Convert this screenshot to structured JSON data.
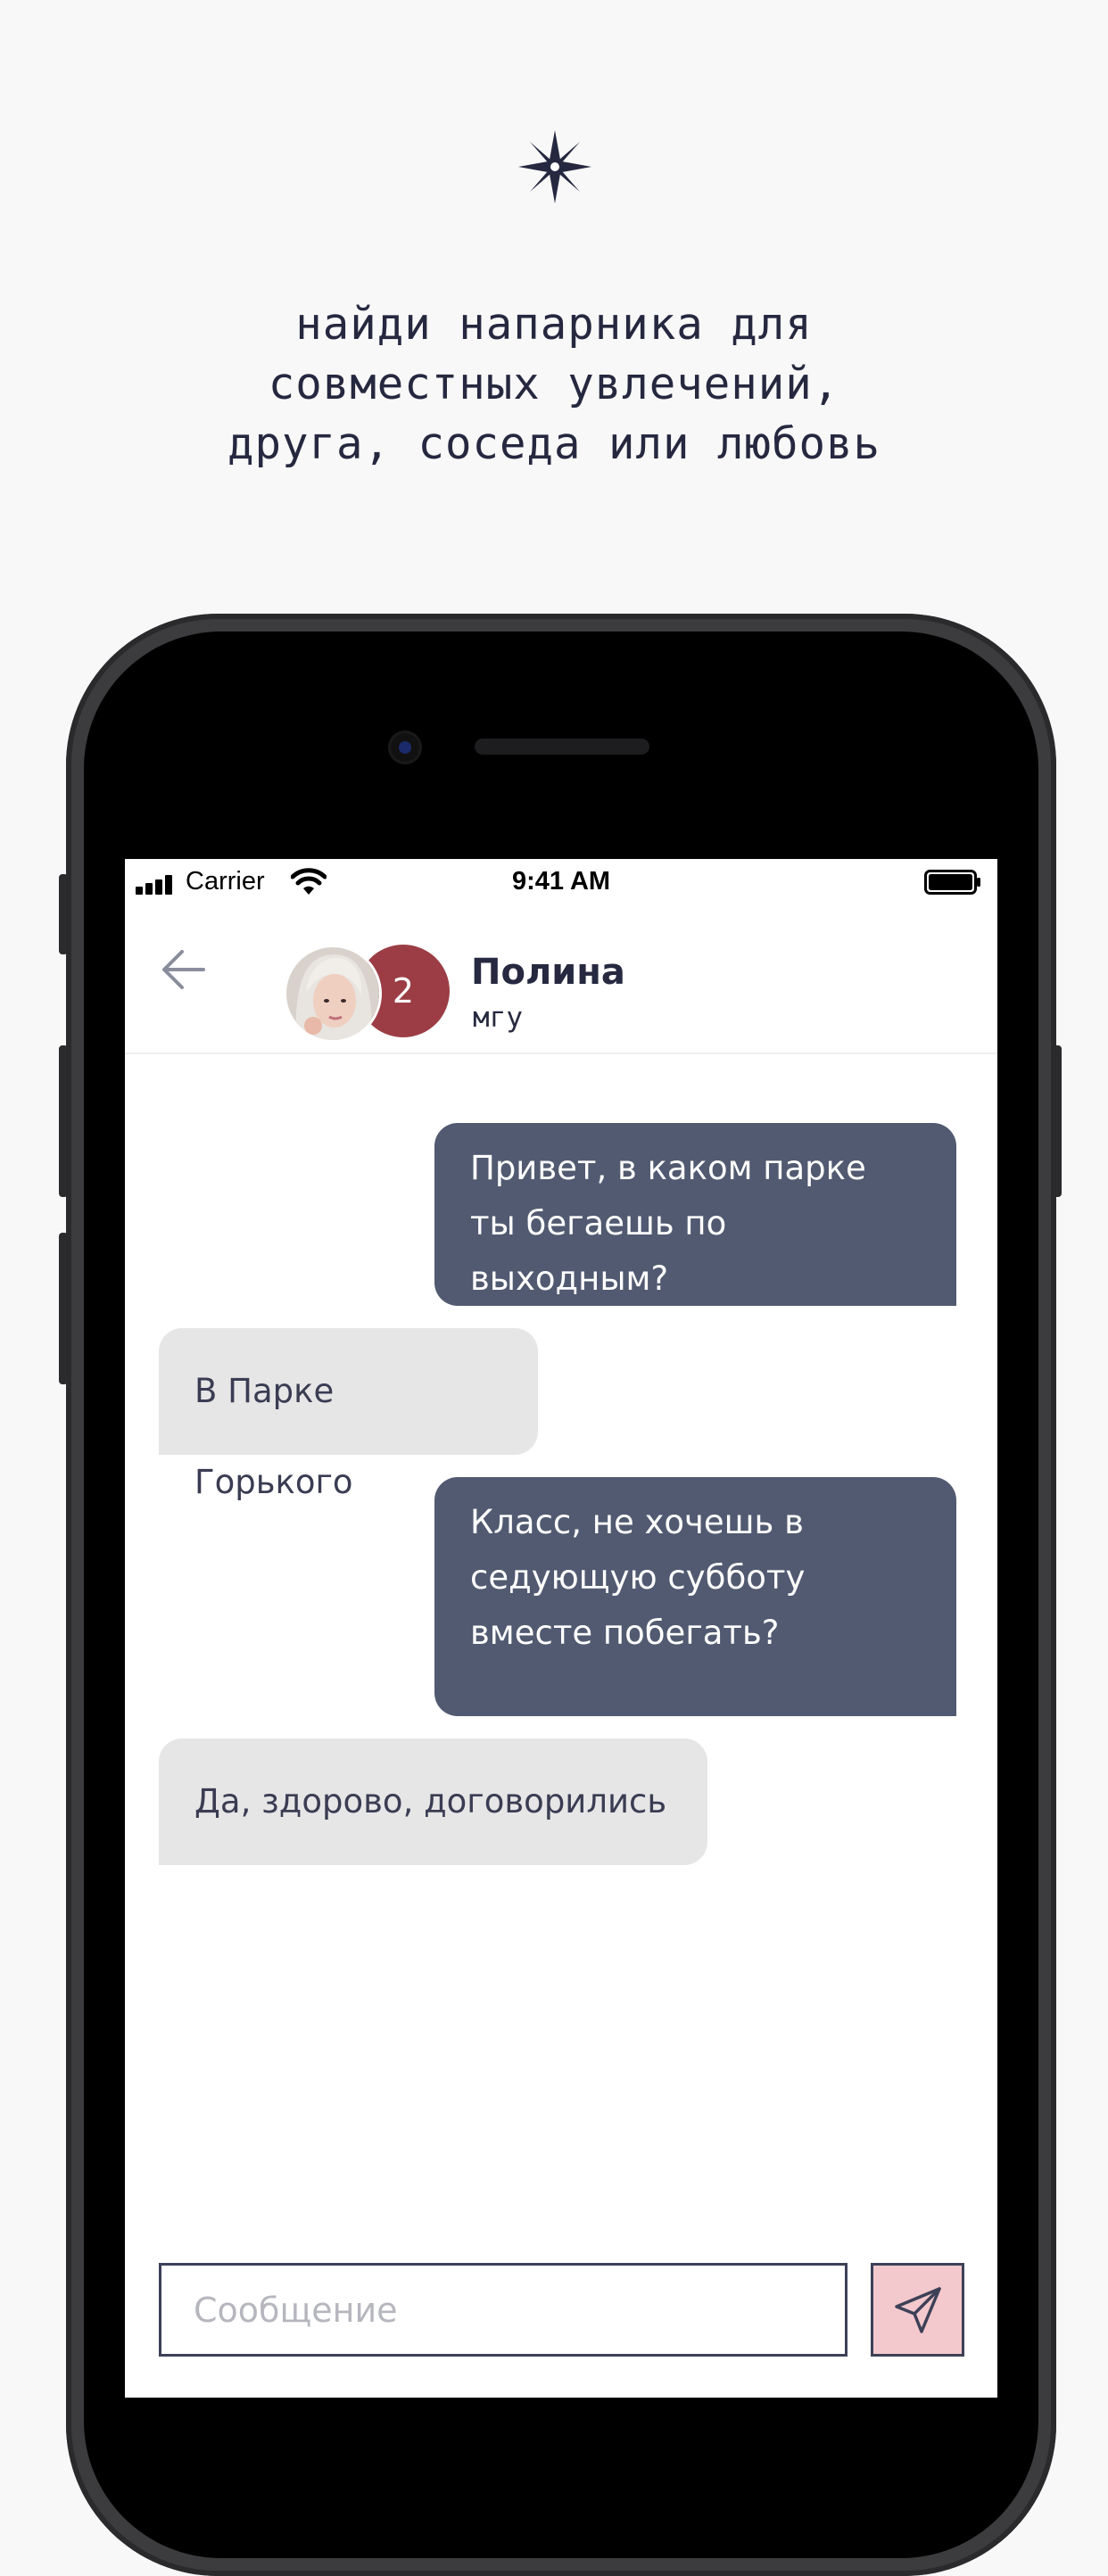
{
  "promo": {
    "tagline_lines": [
      "найди напарника для",
      "совместных увлечений,",
      "друга, соседа или любовь"
    ],
    "logo_icon": "star-logo-icon",
    "accent_color": "#25283f"
  },
  "status_bar": {
    "carrier": "Carrier",
    "time": "9:41 AM"
  },
  "chat_header": {
    "back_icon": "arrow-left-icon",
    "contact_name": "Полина",
    "contact_subtitle": "мгу",
    "badge_count": "2",
    "badge_color": "#9c3d45"
  },
  "messages": [
    {
      "direction": "outgoing",
      "text": "Привет, в каком парке ты бегаешь по выходным?"
    },
    {
      "direction": "incoming",
      "text": "В Парке Горького"
    },
    {
      "direction": "outgoing",
      "text": "Класс, не хочешь в седующую субботу вместе побегать?"
    },
    {
      "direction": "incoming",
      "text": "Да, здорово, договорились"
    }
  ],
  "composer": {
    "placeholder": "Сообщение",
    "value": "",
    "send_icon": "send-paper-plane-icon",
    "send_color": "#f3c9cd"
  },
  "colors": {
    "outgoing_bubble": "#525a71",
    "incoming_bubble": "#e6e6e7"
  }
}
